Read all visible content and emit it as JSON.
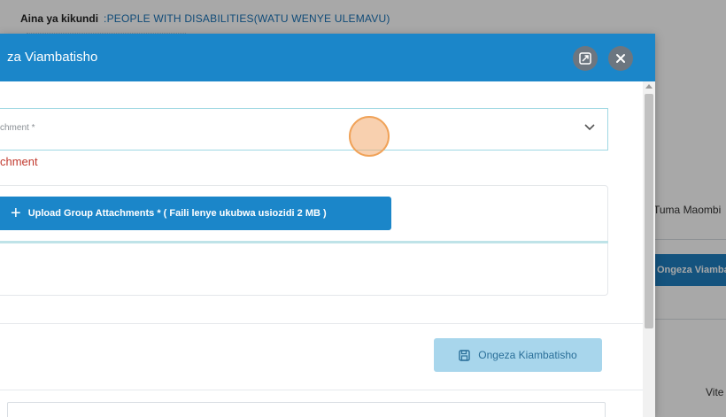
{
  "background": {
    "group_label": "Aina ya kikundi",
    "group_value": ":PEOPLE WITH DISABILITIES(WATU WENYE ULEMAVU)",
    "tuma_label": "Tuma Maombi",
    "ongeza_button": "Ongeza Viambatisho",
    "vite_label": "Vite"
  },
  "modal": {
    "title": "za Viambatisho",
    "expand_icon": "expand-icon",
    "close_icon": "close-icon",
    "select": {
      "label": "chment *",
      "chevron_icon": "chevron-down-icon"
    },
    "error_text": "chment",
    "upload_button": {
      "icon": "plus-icon",
      "label": "Upload Group Attachments * ( Faili lenye ukubwa usiozidi 2 MB )"
    },
    "save_button": {
      "icon": "save-icon",
      "label": "Ongeza Kiambatisho"
    }
  },
  "colors": {
    "header_blue": "#1b86c9",
    "error_red": "#c23a2f",
    "save_button_bg": "#a8d6ec",
    "cursor_orange": "#f0a258"
  }
}
